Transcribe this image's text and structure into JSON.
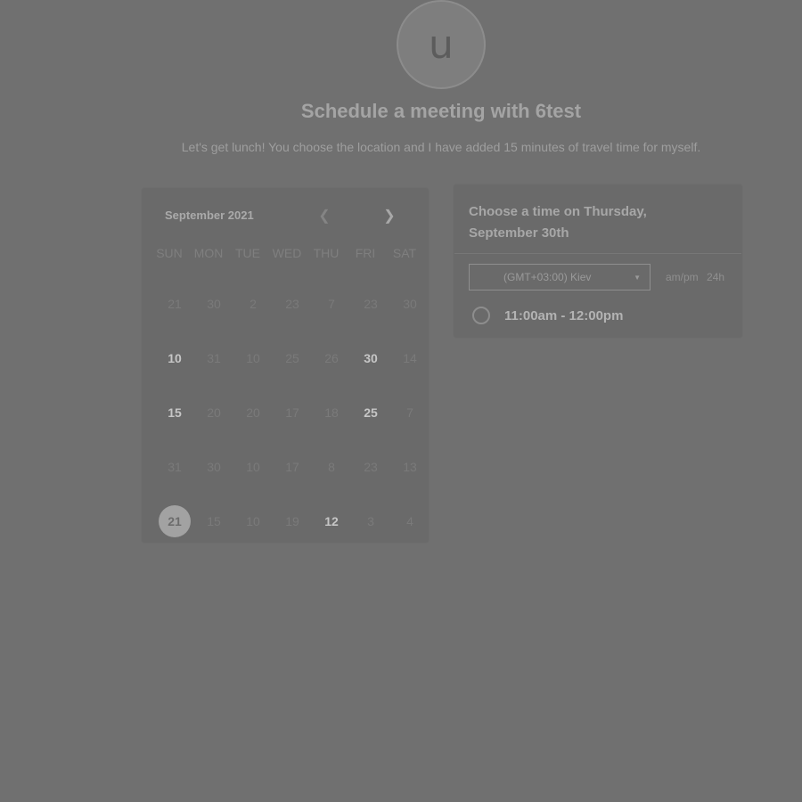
{
  "avatar": {
    "initial": "u"
  },
  "title": "Schedule a meeting with 6test",
  "subtitle": "Let's get lunch! You choose the location and I have added 15 minutes of travel time for myself.",
  "calendar": {
    "month": "September 2021",
    "weekdays": [
      "SUN",
      "MON",
      "TUE",
      "WED",
      "THU",
      "FRI",
      "SAT"
    ],
    "weeks": [
      [
        {
          "d": "21"
        },
        {
          "d": "30"
        },
        {
          "d": "2"
        },
        {
          "d": "23"
        },
        {
          "d": "7"
        },
        {
          "d": "23"
        },
        {
          "d": "30"
        }
      ],
      [
        {
          "d": "10",
          "avail": true
        },
        {
          "d": "31"
        },
        {
          "d": "10"
        },
        {
          "d": "25"
        },
        {
          "d": "26"
        },
        {
          "d": "30",
          "avail": true
        },
        {
          "d": "14"
        }
      ],
      [
        {
          "d": "15",
          "avail": true
        },
        {
          "d": "20"
        },
        {
          "d": "20"
        },
        {
          "d": "17"
        },
        {
          "d": "18"
        },
        {
          "d": "25",
          "avail": true
        },
        {
          "d": "7"
        }
      ],
      [
        {
          "d": "31"
        },
        {
          "d": "30"
        },
        {
          "d": "10"
        },
        {
          "d": "17"
        },
        {
          "d": "8"
        },
        {
          "d": "23"
        },
        {
          "d": "13"
        }
      ],
      [
        {
          "d": "21",
          "selected": true
        },
        {
          "d": "15"
        },
        {
          "d": "10"
        },
        {
          "d": "19"
        },
        {
          "d": "12",
          "avail": true
        },
        {
          "d": "3"
        },
        {
          "d": "4"
        }
      ]
    ]
  },
  "time_panel": {
    "header": "Choose a time on Thursday, September 30th",
    "timezone": "(GMT+03:00) Kiev",
    "format_ampm": "am/pm",
    "format_24h": "24h",
    "slots": [
      "11:00am - 12:00pm"
    ]
  }
}
